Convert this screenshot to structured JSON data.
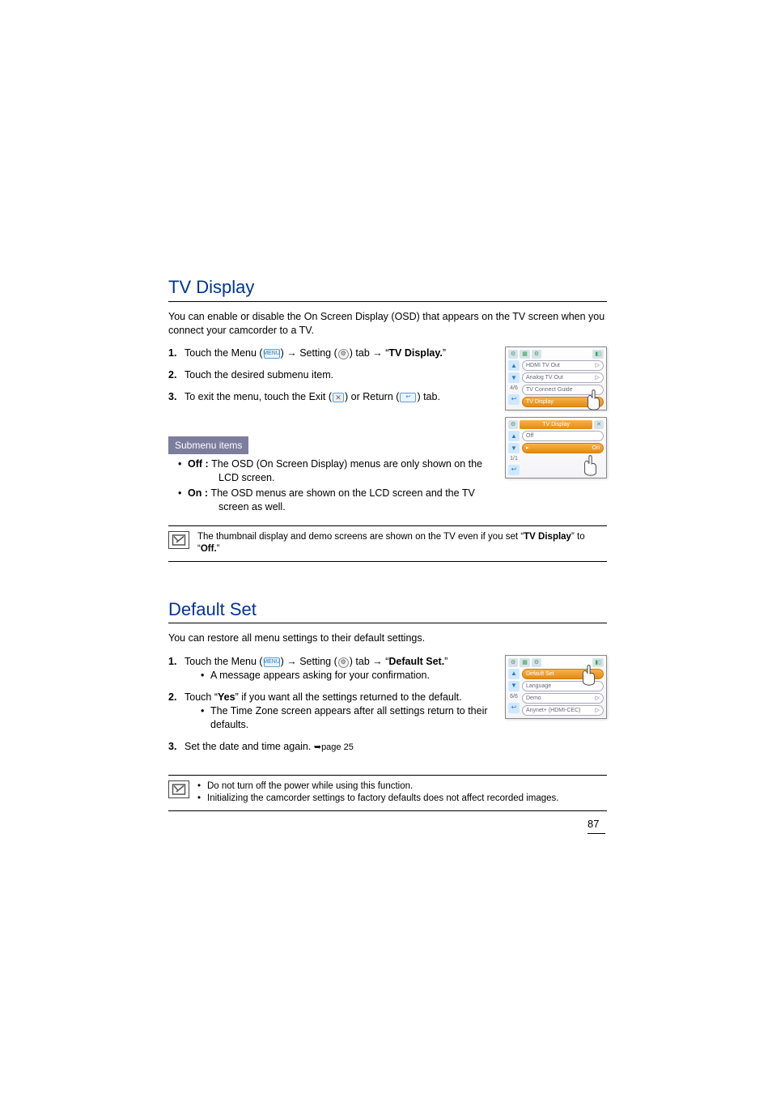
{
  "section1": {
    "title": "TV Display",
    "intro": "You can enable or disable the On Screen Display (OSD) that appears on the TV screen when you connect your camcorder to a TV.",
    "step1a": "Touch the Menu (",
    "step1b": ") ",
    "step1c": " Setting (",
    "step1d": ") tab ",
    "step1e": " “",
    "step1_target": "TV Display.",
    "step1f": "”",
    "step2": "Touch the desired submenu item.",
    "step3a": "To exit the menu, touch the Exit (",
    "step3b": ") or Return (",
    "step3c": ") tab.",
    "submenu_label": "Submenu items",
    "off_label": "Off : ",
    "off_text": "The OSD (On Screen Display) menus are only shown on the",
    "off_text2": "LCD screen.",
    "on_label": "On : ",
    "on_text": "The OSD menus are shown on the LCD screen and the TV",
    "on_text2": "screen as well.",
    "note_a": "The thumbnail display and demo screens are shown on the TV even if you set “",
    "note_b": "TV Display",
    "note_c": "” to “",
    "note_d": "Off.",
    "note_e": "”",
    "screenA": {
      "page": "4/6",
      "items": [
        "HDMI TV Out",
        "Analog TV Out",
        "TV Connect Guide",
        "TV Display"
      ],
      "sel_index": 3
    },
    "screenB": {
      "title": "TV Display",
      "page": "1/1",
      "items": [
        "Off",
        "On"
      ],
      "sel_index": 1
    }
  },
  "section2": {
    "title": "Default Set",
    "intro": "You can restore all menu settings to their default settings.",
    "step1a": "Touch the Menu (",
    "step1b": ") ",
    "step1c": " Setting (",
    "step1d": ") tab ",
    "step1e": " “",
    "step1_target": "Default Set.",
    "step1f": "”",
    "step1_sub": "A message appears asking for your confirmation.",
    "step2a": "Touch “",
    "step2_yes": "Yes",
    "step2b": "” if you want all the settings returned to the default.",
    "step2_sub": "The Time Zone screen appears after all settings return to their defaults.",
    "step3": "Set the date and time again. ",
    "step3_ref": "page 25",
    "note1": "Do not turn off the power while using this function.",
    "note2": "Initializing the camcorder settings to factory defaults does not affect recorded images.",
    "screen": {
      "page": "6/6",
      "items": [
        "Default Set",
        "Language",
        "Demo",
        "Anynet+ (HDMI-CEC)"
      ],
      "sel_index": 0
    }
  },
  "icons": {
    "menu": "MENU",
    "gear": "⚙",
    "exit": "✕",
    "return": "↩",
    "arrow": "→",
    "ref_arrow": "➥"
  },
  "pagenum": "87"
}
